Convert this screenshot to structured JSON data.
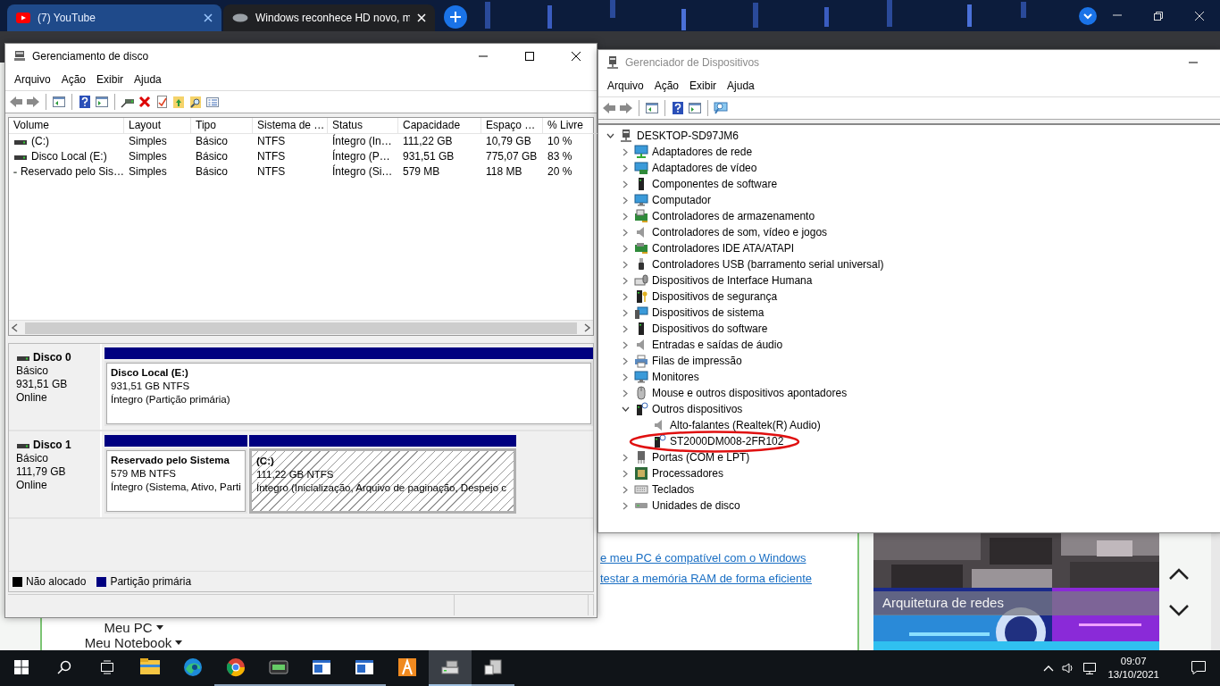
{
  "browser": {
    "tabs": [
      {
        "title": "(7) YouTube",
        "selected": false
      },
      {
        "title": "Windows reconhece HD novo, m",
        "selected": true
      }
    ]
  },
  "page": {
    "links": [
      "e meu PC é compatível com o Windows",
      "testar a memória RAM de forma eficiente"
    ],
    "menu": [
      "Meu PC",
      "Meu Notebook"
    ],
    "card_title": "Arquitetura de redes"
  },
  "disk_window": {
    "title": "Gerenciamento de disco",
    "active": true,
    "menu": [
      "Arquivo",
      "Ação",
      "Exibir",
      "Ajuda"
    ],
    "columns": [
      "Volume",
      "Layout",
      "Tipo",
      "Sistema de …",
      "Status",
      "Capacidade",
      "Espaço …",
      "% Livre"
    ],
    "rows": [
      [
        "(C:)",
        "Simples",
        "Básico",
        "NTFS",
        "Íntegro (In…",
        "111,22 GB",
        "10,79 GB",
        "10 %"
      ],
      [
        "Disco Local  (E:)",
        "Simples",
        "Básico",
        "NTFS",
        "Íntegro (P…",
        "931,51 GB",
        "775,07 GB",
        "83 %"
      ],
      [
        "Reservado pelo Sis…",
        "Simples",
        "Básico",
        "NTFS",
        "Íntegro (Si…",
        "579 MB",
        "118 MB",
        "20 %"
      ]
    ],
    "disks": [
      {
        "name": "Disco 0",
        "type": "Básico",
        "size": "931,51 GB",
        "status": "Online",
        "partitions": [
          {
            "name": "Disco Local   (E:)",
            "size": "931,51 GB NTFS",
            "status": "Íntegro (Partição primária)",
            "selected": false
          }
        ]
      },
      {
        "name": "Disco 1",
        "type": "Básico",
        "size": "111,79 GB",
        "status": "Online",
        "partitions": [
          {
            "name": "Reservado pelo Sistema",
            "size": "579 MB NTFS",
            "status": "Íntegro (Sistema, Ativo, Parti",
            "selected": false
          },
          {
            "name": "(C:)",
            "size": "111,22 GB NTFS",
            "status": "Íntegro (Inicialização, Arquivo de paginação, Despejo c",
            "selected": true
          }
        ]
      }
    ],
    "legend": [
      {
        "label": "Não alocado",
        "color": "#000000"
      },
      {
        "label": "Partição primária",
        "color": "#000080"
      }
    ]
  },
  "device_window": {
    "title": "Gerenciador de Dispositivos",
    "active": false,
    "menu": [
      "Arquivo",
      "Ação",
      "Exibir",
      "Ajuda"
    ],
    "tree": {
      "label": "DESKTOP-SD97JM6",
      "expanded": true,
      "children": [
        {
          "label": "Adaptadores de rede",
          "expanded": false
        },
        {
          "label": "Adaptadores de vídeo",
          "expanded": false
        },
        {
          "label": "Componentes de software",
          "expanded": false
        },
        {
          "label": "Computador",
          "expanded": false
        },
        {
          "label": "Controladores de armazenamento",
          "expanded": false
        },
        {
          "label": "Controladores de som, vídeo e jogos",
          "expanded": false
        },
        {
          "label": "Controladores IDE ATA/ATAPI",
          "expanded": false
        },
        {
          "label": "Controladores USB (barramento serial universal)",
          "expanded": false
        },
        {
          "label": "Dispositivos de Interface Humana",
          "expanded": false
        },
        {
          "label": "Dispositivos de segurança",
          "expanded": false
        },
        {
          "label": "Dispositivos de sistema",
          "expanded": false
        },
        {
          "label": "Dispositivos do software",
          "expanded": false
        },
        {
          "label": "Entradas e saídas de áudio",
          "expanded": false
        },
        {
          "label": "Filas de impressão",
          "expanded": false
        },
        {
          "label": "Monitores",
          "expanded": false
        },
        {
          "label": "Mouse e outros dispositivos apontadores",
          "expanded": false
        },
        {
          "label": "Outros dispositivos",
          "expanded": true,
          "children": [
            {
              "label": "Alto-falantes (Realtek(R) Audio)",
              "circled": false
            },
            {
              "label": "ST2000DM008-2FR102",
              "circled": true
            }
          ]
        },
        {
          "label": "Portas (COM e LPT)",
          "expanded": false
        },
        {
          "label": "Processadores",
          "expanded": false
        },
        {
          "label": "Teclados",
          "expanded": false
        },
        {
          "label": "Unidades de disco",
          "expanded": false
        }
      ]
    }
  },
  "taskbar": {
    "apps": [
      {
        "kind": "folder",
        "running": false,
        "selected": false
      },
      {
        "kind": "edge",
        "running": false,
        "selected": false
      },
      {
        "kind": "chrome",
        "running": true,
        "selected": false
      },
      {
        "kind": "chip",
        "running": true,
        "selected": false
      },
      {
        "kind": "panel",
        "running": true,
        "selected": false
      },
      {
        "kind": "panel",
        "running": true,
        "selected": false
      },
      {
        "kind": "orange",
        "running": false,
        "selected": false
      },
      {
        "kind": "disk",
        "running": true,
        "selected": true
      },
      {
        "kind": "device",
        "running": true,
        "selected": false
      }
    ],
    "time": "09:07",
    "date": "13/10/2021"
  }
}
